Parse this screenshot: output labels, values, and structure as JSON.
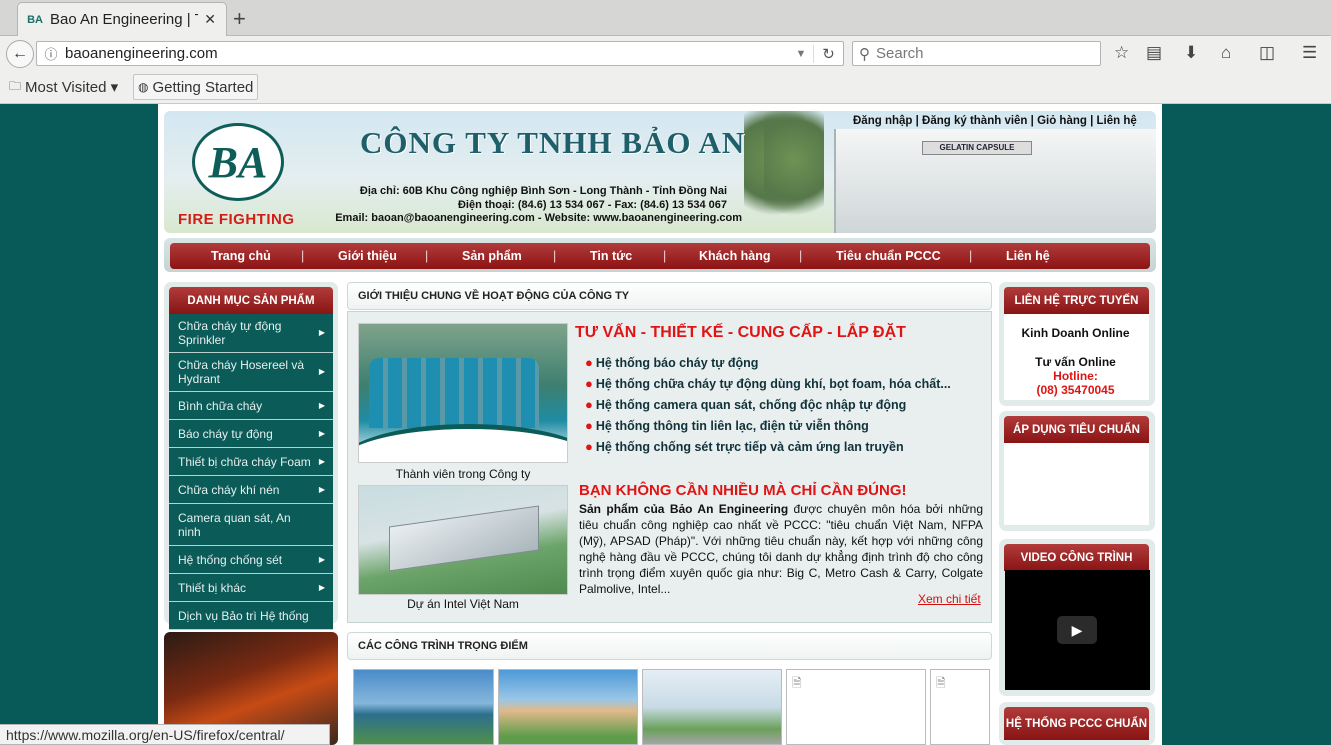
{
  "browser": {
    "tab_title": "Bao An Engineering | Tr",
    "tab_favicon": "BA",
    "tab_close": "✕",
    "new_tab": "+",
    "url": "baoanengineering.com",
    "search_placeholder": "Search",
    "bookmarks": [
      {
        "label": "Most Visited ▾",
        "icon": "folder-icon"
      },
      {
        "label": "Getting Started",
        "icon": "globe-icon"
      }
    ],
    "status_url": "https://www.mozilla.org/en-US/firefox/central/"
  },
  "header": {
    "logo_text": "BA",
    "fire_fighting": "FIRE FIGHTING",
    "company_name": "CÔNG TY TNHH BẢO AN",
    "address": "Địa chỉ: 60B Khu Công nghiệp Bình Sơn - Long Thành - Tỉnh Đồng Nai",
    "phone": "Điện thoại: (84.6) 13 534 067 - Fax: (84.6) 13 534 067",
    "email": "Email: baoan@baoanengineering.com - Website: www.baoanengineering.com",
    "building_sign": "GELATIN CAPSULE",
    "top_links": "Đăng nhập | Đăng ký thành viên | Giỏ hàng | Liên hệ"
  },
  "menu": {
    "items": [
      "Trang chủ",
      "Giới thiệu",
      "Sản phẩm",
      "Tin tức",
      "Khách hàng",
      "Tiêu chuẩn PCCC",
      "Liên hệ"
    ],
    "separator": "|"
  },
  "categories": {
    "title": "DANH MỤC SẢN PHẨM",
    "items": [
      "Chữa cháy tự động Sprinkler",
      "Chữa cháy Hosereel và Hydrant",
      "Bình chữa cháy",
      "Báo cháy tự động",
      "Thiết bị chữa cháy Foam",
      "Chữa cháy khí nén",
      "Camera quan sát, An ninh",
      "Hệ thống chống sét",
      "Thiết bị khác",
      "Dịch vụ Bảo trì Hệ thống"
    ]
  },
  "intro": {
    "title": "GIỚI THIỆU CHUNG VỀ HOẠT ĐỘNG CỦA CÔNG TY",
    "photo1_caption": "Thành viên trong Công ty",
    "heading1": "TƯ VẤN - THIẾT KẾ - CUNG CẤP - LẮP ĐẶT",
    "bullets": [
      "Hệ thống báo cháy tự động",
      "Hệ thống chữa cháy tự động dùng khí, bọt foam, hóa chất...",
      "Hệ thống camera quan sát, chống độc nhập tự động",
      "Hệ thống thông tin liên lạc, điện tử viễn thông",
      "Hệ thống chống sét trực tiếp và cảm ứng lan truyền"
    ],
    "photo2_caption": "Dự án Intel Việt Nam",
    "heading2": "BẠN KHÔNG CẦN NHIỀU MÀ CHỈ CẦN ĐÚNG!",
    "para_bold": "Sản phẩm của Bảo An Engineering",
    "para_rest": " được chuyên môn hóa bởi những tiêu chuẩn công nghiệp cao nhất về PCCC: \"tiêu chuẩn Việt Nam, NFPA (Mỹ), APSAD (Pháp)\". Với những tiêu chuẩn này, kết hợp với những công nghệ hàng đầu về PCCC, chúng tôi danh dự khẳng định trình độ cho công trình trọng điểm xuyên quốc gia như: Big C, Metro Cash & Carry, Colgate Palmolive, Intel...",
    "more_link": "Xem chi tiết"
  },
  "projects": {
    "title": "CÁC CÔNG TRÌNH TRỌNG ĐIỂM"
  },
  "right": {
    "support_title": "LIÊN HỆ TRỰC TUYẾN",
    "sales": "Kinh Doanh Online",
    "consult": "Tư vấn Online",
    "hotline_label": "Hotline:",
    "hotline_number": "(08) 35470045",
    "standards_title": "ÁP DỤNG TIÊU CHUẨN",
    "video_title": "VIDEO CÔNG TRÌNH",
    "pccc_title": "HỆ THỐNG PCCC CHUẨN"
  },
  "colors": {
    "accent_red": "#891414",
    "teal": "#0b5b59",
    "background": "#075a57"
  }
}
